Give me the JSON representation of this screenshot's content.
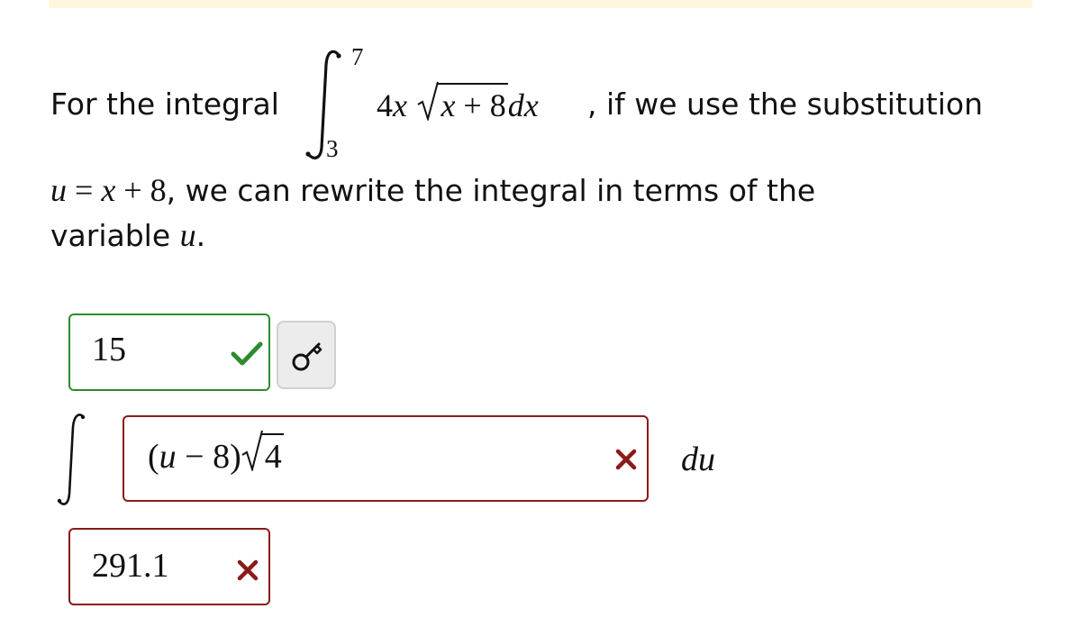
{
  "question": {
    "text_before_integral": "For the integral",
    "integral": {
      "lower_limit": "3",
      "upper_limit": "7",
      "integrand_coeff": "4",
      "integrand_var": "x",
      "radicand_var": "x",
      "radicand_op": " + ",
      "radicand_const": "8",
      "differential": "dx"
    },
    "text_after_integral": ", if we use the substitution",
    "substitution": {
      "lhs": "u",
      "eq": " = ",
      "rhs_var": "x",
      "rhs_op": " + ",
      "rhs_const": "8"
    },
    "text_line2": ", we can rewrite the integral in terms of the",
    "text_line3_prefix": "variable ",
    "text_line3_var": "u",
    "text_line3_suffix": "."
  },
  "answers": {
    "bound_field": {
      "value": "15",
      "status": "correct",
      "status_color": "#2e8b2e"
    },
    "key_button": {
      "icon": "key-icon"
    },
    "integrand_field": {
      "open_paren": "(",
      "var": "u",
      "op": " − ",
      "const": "8",
      "close_paren": ")",
      "radicand": "4",
      "status": "incorrect",
      "status_color": "#8b1a1a"
    },
    "differential": "du",
    "result_field": {
      "value": "291.1",
      "status": "incorrect",
      "status_color": "#8b1a1a"
    }
  },
  "colors": {
    "banner": "#fdf6dc",
    "correct": "#2e8b2e",
    "incorrect": "#8b1a1a"
  }
}
